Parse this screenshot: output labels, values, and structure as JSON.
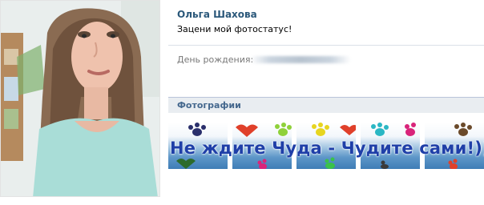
{
  "profile": {
    "name": "Ольга Шахова",
    "status": "Зацени мой фотостатус!",
    "birthday_label": "День рождения:",
    "birthday_value_hidden": true
  },
  "photos": {
    "section_title": "Фотографии",
    "overlay_text": "Не ждите Чуда - Чудите сами!)))",
    "thumbnail_count": 5
  },
  "colors": {
    "name": "#2b587a",
    "header_bg": "#e9edf1",
    "header_text": "#45688e",
    "overlay_text": "#1f3fa8"
  }
}
